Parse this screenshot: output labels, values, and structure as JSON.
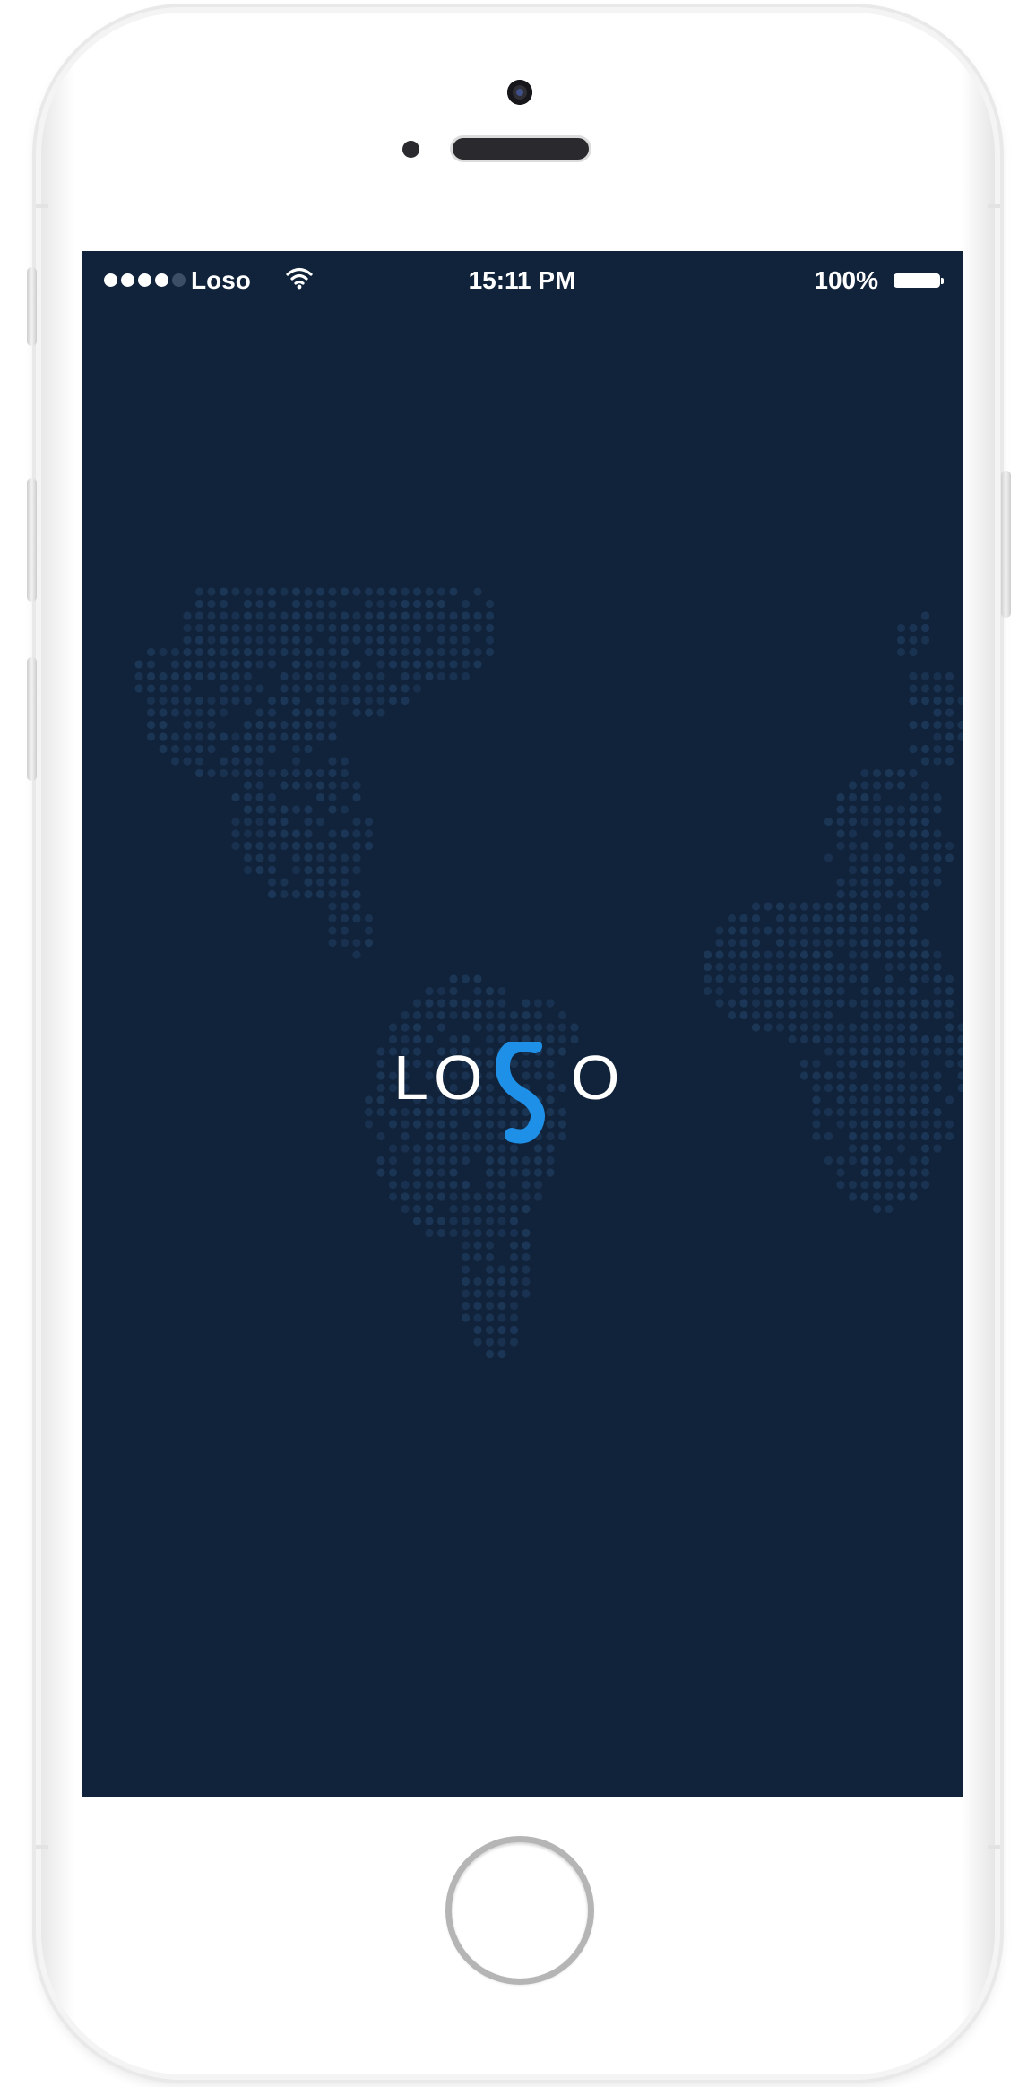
{
  "status_bar": {
    "carrier": "Loso",
    "time": "15:11 PM",
    "battery_percent": "100%",
    "signal_bars_filled": 4,
    "signal_bars_total": 5,
    "battery_level": 1.0
  },
  "splash": {
    "brand": "LOSO",
    "logo_letters": [
      "L",
      "O",
      "S",
      "O"
    ],
    "background_color": "#11233a",
    "accent_color": "#1e90e8",
    "map_dot_color": "#1e3a5c"
  },
  "device": {
    "camera": "camera-icon",
    "speaker": "speaker-grille",
    "home": "home-button"
  }
}
